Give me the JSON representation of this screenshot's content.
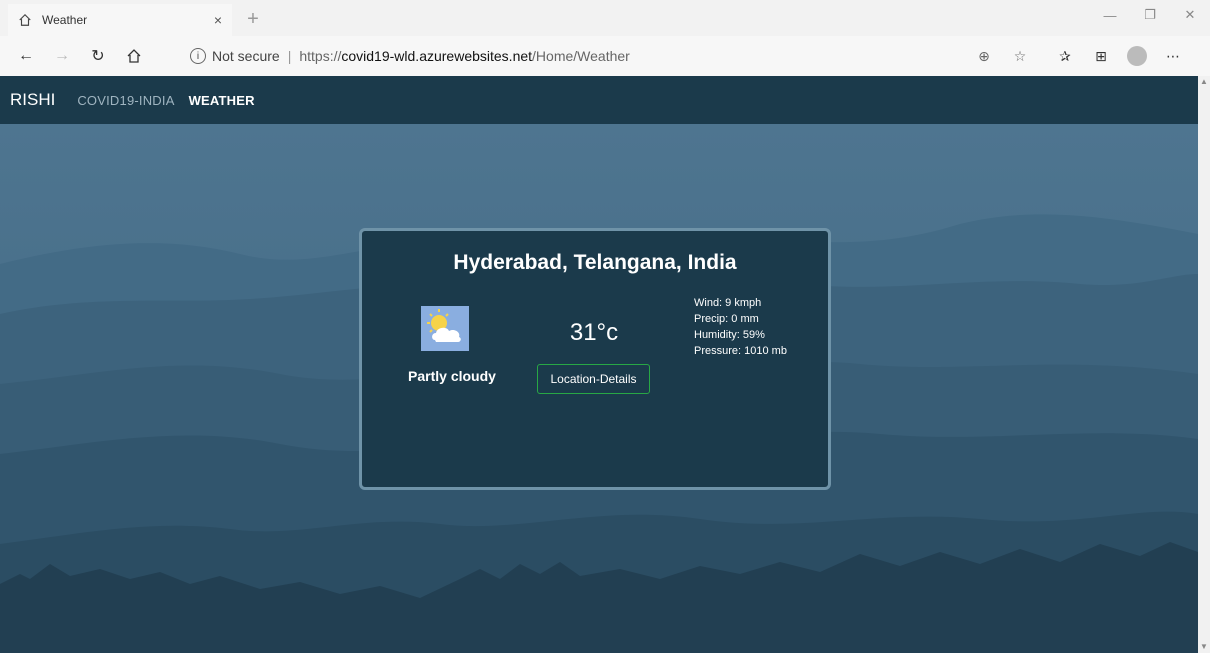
{
  "browser": {
    "tab_title": "Weather",
    "tab_close": "×",
    "new_tab": "+",
    "address": {
      "security": "Not secure",
      "separator": "|",
      "url_scheme": "https://",
      "url_domain": "covid19-wld.azurewebsites.net",
      "url_path": "/Home/Weather"
    },
    "window_controls": [
      "minimize-icon",
      "restore-icon",
      "close-icon"
    ],
    "more_label": "⋯"
  },
  "site": {
    "brand": "RISHI",
    "nav": [
      {
        "label": "COVID19-INDIA",
        "active": false
      },
      {
        "label": "WEATHER",
        "active": true
      }
    ]
  },
  "weather": {
    "location": "Hyderabad, Telangana, India",
    "temperature": "31°c",
    "condition": "Partly cloudy",
    "button_label": "Location-Details",
    "wind": "Wind: 9 kmph",
    "precip": "Precip: 0 mm",
    "humidity": "Humidity: 59%",
    "pressure": "Pressure: 1010 mb"
  },
  "colors": {
    "nav_bg": "#1b3a4b",
    "card_bg": "#1b3a4b",
    "card_border": "#6f93a8",
    "button_border": "#28a745"
  }
}
